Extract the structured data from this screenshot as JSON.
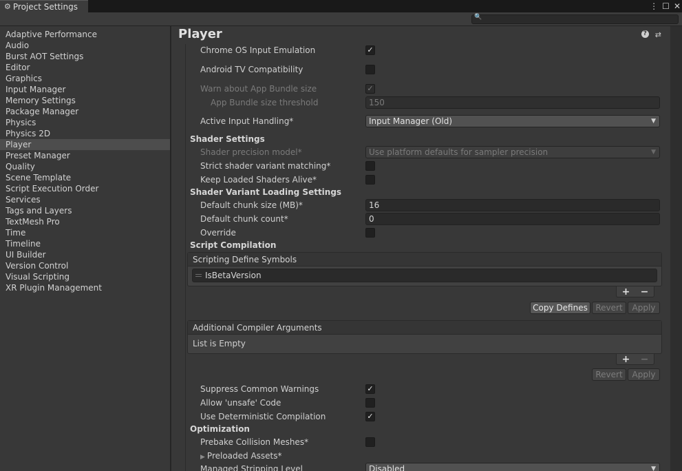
{
  "window": {
    "tab_title": "Project Settings",
    "tab_icon": "gear-icon",
    "controls": [
      "more-icon",
      "maximize-icon",
      "close-icon"
    ]
  },
  "search": {
    "placeholder": "",
    "icon": "search-icon"
  },
  "sidebar": {
    "items": [
      "Adaptive Performance",
      "Audio",
      "Burst AOT Settings",
      "Editor",
      "Graphics",
      "Input Manager",
      "Memory Settings",
      "Package Manager",
      "Physics",
      "Physics 2D",
      "Player",
      "Preset Manager",
      "Quality",
      "Scene Template",
      "Script Execution Order",
      "Services",
      "Tags and Layers",
      "TextMesh Pro",
      "Time",
      "Timeline",
      "UI Builder",
      "Version Control",
      "Visual Scripting",
      "XR Plugin Management"
    ],
    "selected": "Player"
  },
  "panel": {
    "title": "Player",
    "header_icons": [
      "help-icon",
      "preset-icon",
      "more-icon"
    ]
  },
  "settings": {
    "chrome_os_input_emulation": {
      "label": "Chrome OS Input Emulation",
      "checked": true
    },
    "android_tv_compatibility": {
      "label": "Android TV Compatibility",
      "checked": false
    },
    "warn_app_bundle_size": {
      "label": "Warn about App Bundle size",
      "checked": true
    },
    "app_bundle_size_threshold": {
      "label": "App Bundle size threshold",
      "value": "150"
    },
    "active_input_handling": {
      "label": "Active Input Handling*",
      "value": "Input Manager (Old)"
    },
    "shader_settings": {
      "heading": "Shader Settings"
    },
    "shader_precision_model": {
      "label": "Shader precision model*",
      "value": "Use platform defaults for sampler precision"
    },
    "strict_shader_variant_matching": {
      "label": "Strict shader variant matching*",
      "checked": false
    },
    "keep_loaded_shaders_alive": {
      "label": "Keep Loaded Shaders Alive*",
      "checked": false
    },
    "shader_variant_loading": {
      "heading": "Shader Variant Loading Settings"
    },
    "default_chunk_size": {
      "label": "Default chunk size (MB)*",
      "value": "16"
    },
    "default_chunk_count": {
      "label": "Default chunk count*",
      "value": "0"
    },
    "override": {
      "label": "Override",
      "checked": false
    },
    "script_compilation": {
      "heading": "Script Compilation"
    },
    "scripting_define_symbols": {
      "header": "Scripting Define Symbols",
      "entries": [
        "IsBetaVersion"
      ],
      "plus": "+",
      "minus": "−"
    },
    "define_buttons": {
      "copy": "Copy Defines",
      "revert": "Revert",
      "apply": "Apply"
    },
    "additional_compiler_arguments": {
      "header": "Additional Compiler Arguments",
      "empty_text": "List is Empty",
      "plus": "+",
      "minus": "−"
    },
    "compiler_buttons": {
      "revert": "Revert",
      "apply": "Apply"
    },
    "suppress_common_warnings": {
      "label": "Suppress Common Warnings",
      "checked": true
    },
    "allow_unsafe_code": {
      "label": "Allow 'unsafe' Code",
      "checked": false
    },
    "use_deterministic_compilation": {
      "label": "Use Deterministic Compilation",
      "checked": true
    },
    "optimization": {
      "heading": "Optimization"
    },
    "prebake_collision_meshes": {
      "label": "Prebake Collision Meshes*",
      "checked": false
    },
    "preloaded_assets": {
      "label": "Preloaded Assets*"
    },
    "managed_stripping_level": {
      "label": "Managed Stripping Level",
      "value": "Disabled"
    }
  },
  "colors": {
    "background": "#383838",
    "titlebar": "#191919",
    "selected_item": "#4d4d4d",
    "field_bg": "#2a2a2a"
  }
}
